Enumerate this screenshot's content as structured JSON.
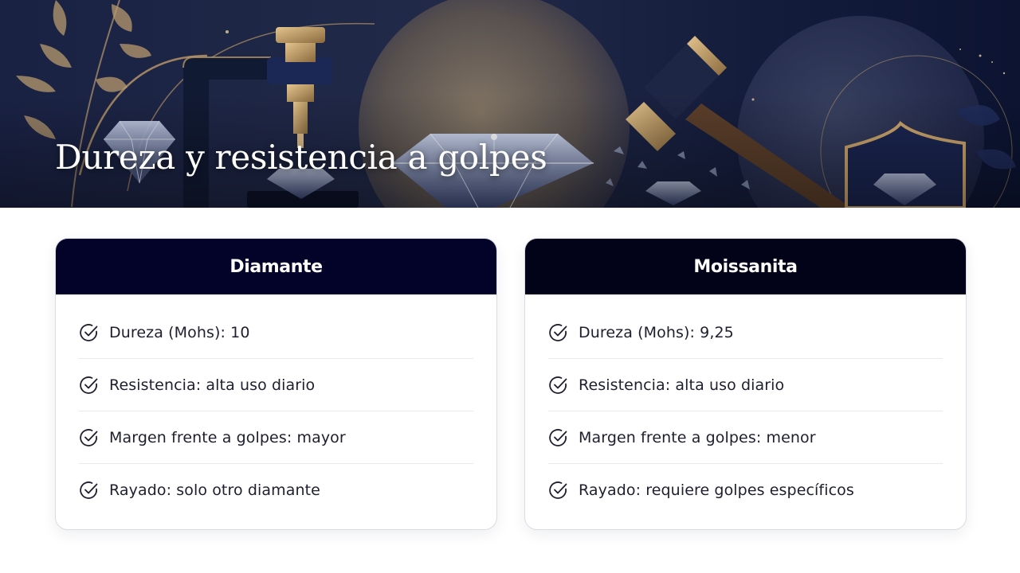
{
  "slide": {
    "title": "Dureza y resistencia a golpes"
  },
  "cards": [
    {
      "heading": "Diamante",
      "items": [
        {
          "text": "Dureza (Mohs): 10",
          "icon": "check-circle-icon"
        },
        {
          "text": "Resistencia: alta uso diario",
          "icon": "check-circle-icon"
        },
        {
          "text": "Margen frente a golpes: mayor",
          "icon": "check-circle-icon"
        },
        {
          "text": "Rayado: solo otro diamante",
          "icon": "check-circle-icon"
        }
      ]
    },
    {
      "heading": "Moissanita",
      "items": [
        {
          "text": "Dureza (Mohs): 9,25",
          "icon": "check-circle-icon"
        },
        {
          "text": "Resistencia: alta uso diario",
          "icon": "check-circle-icon"
        },
        {
          "text": "Margen frente a golpes: menor",
          "icon": "check-circle-icon"
        },
        {
          "text": "Rayado: requiere golpes específicos",
          "icon": "check-circle-icon"
        }
      ]
    }
  ],
  "colors": {
    "banner_bg": "#10183a",
    "header_bg": "#03032a",
    "text": "#1e1f2e",
    "accent_gold": "#c9a36b"
  }
}
